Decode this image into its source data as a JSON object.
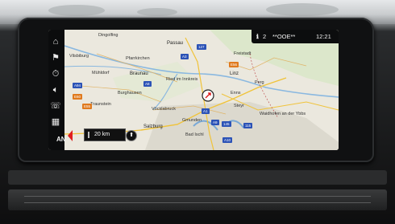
{
  "status": {
    "num": "2",
    "station": "**OOE**",
    "time": "12:21"
  },
  "scale": {
    "distance": "20 km"
  },
  "bottom_left": {
    "an": "AN"
  },
  "places": [
    {
      "name": "Dingolfing",
      "big": false
    },
    {
      "name": "Passau",
      "big": true
    },
    {
      "name": "Freistadt",
      "big": false
    },
    {
      "name": "Vilsbiburg",
      "big": false
    },
    {
      "name": "Pfarrkirchen",
      "big": false
    },
    {
      "name": "Mühldorf",
      "big": false
    },
    {
      "name": "Braunau",
      "big": true
    },
    {
      "name": "Ried im Innkreis",
      "big": false
    },
    {
      "name": "Linz",
      "big": true
    },
    {
      "name": "Perg",
      "big": false
    },
    {
      "name": "Enns",
      "big": false
    },
    {
      "name": "Steyr",
      "big": false
    },
    {
      "name": "Burghausen",
      "big": false
    },
    {
      "name": "Traunstein",
      "big": false
    },
    {
      "name": "Vöcklabruck",
      "big": false
    },
    {
      "name": "Gmunden",
      "big": false
    },
    {
      "name": "Waidhofen an der Ybbs",
      "big": false
    },
    {
      "name": "Salzburg",
      "big": true
    },
    {
      "name": "Bad Ischl",
      "big": false
    }
  ],
  "road_shields": [
    {
      "text": "A3",
      "color": "blue"
    },
    {
      "text": "E56",
      "color": "orange"
    },
    {
      "text": "A8",
      "color": "blue"
    },
    {
      "text": "A1",
      "color": "blue"
    },
    {
      "text": "127",
      "color": "blue"
    },
    {
      "text": "A94",
      "color": "blue"
    },
    {
      "text": "A9",
      "color": "blue"
    },
    {
      "text": "145",
      "color": "blue"
    },
    {
      "text": "115",
      "color": "blue"
    },
    {
      "text": "E55",
      "color": "orange"
    },
    {
      "text": "A10",
      "color": "blue"
    },
    {
      "text": "E60",
      "color": "orange"
    }
  ],
  "colors": {
    "map_bg": "#e9e6dc",
    "sidebar": "#0b0c0d",
    "accent_red": "#e02020",
    "road_yellow": "#f0c33a"
  }
}
